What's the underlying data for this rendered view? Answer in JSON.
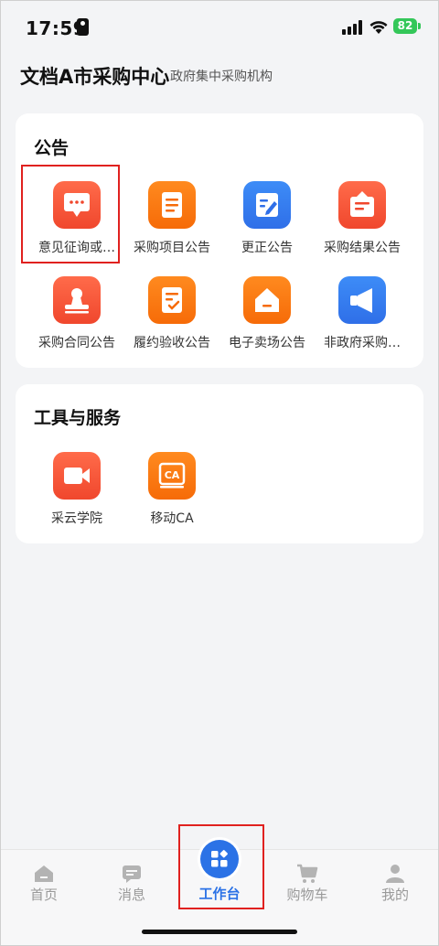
{
  "status_bar": {
    "time": "17:59",
    "battery": "82"
  },
  "header": {
    "org_name": "文档A市采购中心",
    "subtitle": "政府集中采购机构"
  },
  "announcements": {
    "title": "公告",
    "items": [
      {
        "label": "意见征询或…",
        "icon": "comment-icon",
        "color": "red"
      },
      {
        "label": "采购项目公告",
        "icon": "document-icon",
        "color": "orange"
      },
      {
        "label": "更正公告",
        "icon": "edit-icon",
        "color": "blue"
      },
      {
        "label": "采购结果公告",
        "icon": "result-icon",
        "color": "red"
      },
      {
        "label": "采购合同公告",
        "icon": "contract-stamp-icon",
        "color": "red"
      },
      {
        "label": "履约验收公告",
        "icon": "checklist-icon",
        "color": "orange"
      },
      {
        "label": "电子卖场公告",
        "icon": "store-icon",
        "color": "orange"
      },
      {
        "label": "非政府采购…",
        "icon": "megaphone-icon",
        "color": "blue"
      }
    ]
  },
  "tools": {
    "title": "工具与服务",
    "items": [
      {
        "label": "采云学院",
        "icon": "video-camera-icon",
        "color": "red"
      },
      {
        "label": "移动CA",
        "icon": "ca-certificate-icon",
        "color": "orange"
      }
    ]
  },
  "bottom_nav": {
    "items": [
      {
        "label": "首页",
        "icon": "home-icon"
      },
      {
        "label": "消息",
        "icon": "message-icon"
      },
      {
        "label": "工作台",
        "icon": "workbench-icon",
        "active": true
      },
      {
        "label": "购物车",
        "icon": "cart-icon"
      },
      {
        "label": "我的",
        "icon": "profile-icon"
      }
    ]
  },
  "colors": {
    "accent": "#2b72e6",
    "orange": "#f66b08",
    "red": "#f0472d",
    "blue": "#2f6fe8",
    "highlight": "#e0211f"
  }
}
